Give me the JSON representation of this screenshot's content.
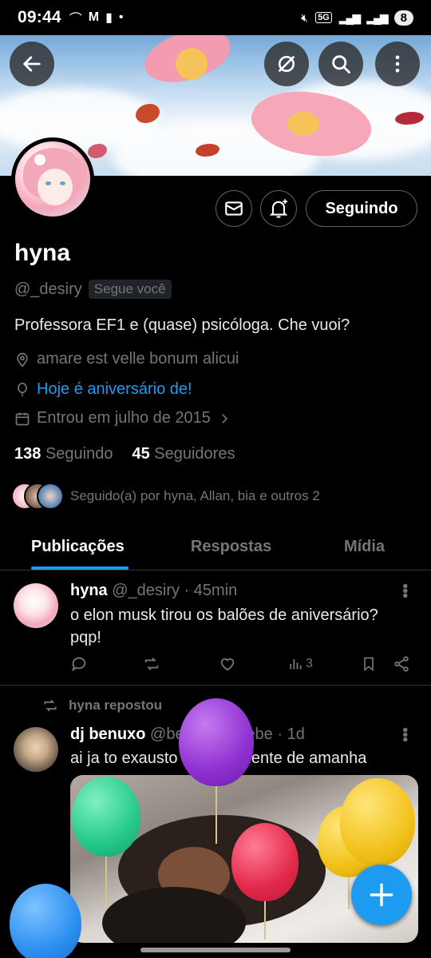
{
  "status_bar": {
    "time": "09:44",
    "network": "5G",
    "battery": "8"
  },
  "profile": {
    "name": "hyna",
    "handle": "@_desiry",
    "follows_you": "Segue você",
    "bio": "Professora EF1 e (quase) psicóloga. Che vuoi?",
    "location": "amare est velle bonum alicui",
    "birthday": "Hoje é aniversário de!",
    "joined": "Entrou em julho de 2015",
    "following_count": "138",
    "following_label": "Seguindo",
    "followers_count": "45",
    "followers_label": "Seguidores",
    "followed_by": "Seguido(a) por hyna, Allan, bia e outros 2",
    "following_button": "Seguindo"
  },
  "tabs": [
    {
      "label": "Publicações",
      "active": true
    },
    {
      "label": "Respostas",
      "active": false
    },
    {
      "label": "Mídia",
      "active": false
    }
  ],
  "posts": [
    {
      "name": "hyna",
      "handle": "@_desiry",
      "time": "· 45min",
      "text_line1": "o elon musk tirou os balões de aniversário?",
      "text_line2": "pqp!",
      "views": "3"
    },
    {
      "repost_label": "hyna repostou",
      "name": "dj benuxo",
      "handle": "@bebebenebebe",
      "time": "· 1d",
      "text": "ai ja to exausto do expediente de amanha"
    }
  ],
  "colors": {
    "accent": "#1d9bf0",
    "background": "#000000",
    "secondary_text": "#71767b"
  },
  "icons": [
    "back-arrow-icon",
    "grok-icon",
    "search-icon",
    "more-vertical-icon",
    "mail-icon",
    "bell-plus-icon",
    "location-icon",
    "balloon-icon",
    "calendar-icon",
    "chevron-right-icon",
    "reply-icon",
    "retweet-icon",
    "like-icon",
    "views-icon",
    "bookmark-icon",
    "share-icon",
    "compose-plus-icon"
  ]
}
